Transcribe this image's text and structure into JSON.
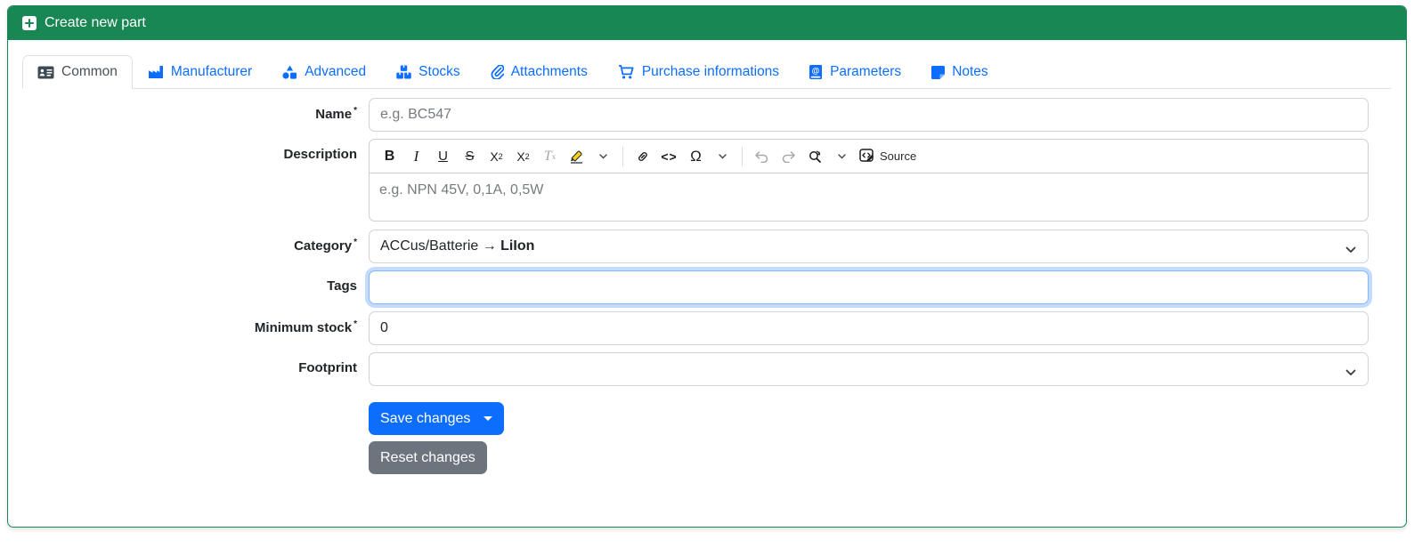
{
  "header": {
    "title": "Create new part",
    "icon": "plus-square-icon",
    "background": "#198754"
  },
  "tabs": [
    {
      "label": "Common",
      "icon": "id-card-icon",
      "active": true
    },
    {
      "label": "Manufacturer",
      "icon": "factory-icon",
      "active": false
    },
    {
      "label": "Advanced",
      "icon": "shapes-icon",
      "active": false
    },
    {
      "label": "Stocks",
      "icon": "boxes-icon",
      "active": false
    },
    {
      "label": "Attachments",
      "icon": "paperclip-icon",
      "active": false
    },
    {
      "label": "Purchase informations",
      "icon": "cart-icon",
      "active": false
    },
    {
      "label": "Parameters",
      "icon": "book-at-icon",
      "active": false
    },
    {
      "label": "Notes",
      "icon": "sticky-note-icon",
      "active": false
    }
  ],
  "form": {
    "name": {
      "label": "Name",
      "required_marker": "*",
      "placeholder": "e.g. BC547",
      "value": ""
    },
    "description": {
      "label": "Description",
      "placeholder": "e.g. NPN 45V, 0,1A, 0,5W"
    },
    "category": {
      "label": "Category",
      "required_marker": "*",
      "value_prefix": "ACCus/Batterie → ",
      "value_selected": "LiIon"
    },
    "tags": {
      "label": "Tags",
      "value": "",
      "focused": true
    },
    "minimum_stock": {
      "label": "Minimum stock",
      "required_marker": "*",
      "value": "0"
    },
    "footprint": {
      "label": "Footprint",
      "value": ""
    }
  },
  "editor_toolbar": {
    "bold": "B",
    "italic": "I",
    "underline": "U",
    "strikethrough": "S",
    "subscript_base": "X",
    "subscript_small": "2",
    "superscript_base": "X",
    "superscript_small": "2",
    "remove_format_base": "T",
    "remove_format_small": "x",
    "code": "<>",
    "special_char": "Ω",
    "source_label": "Source"
  },
  "buttons": {
    "save": "Save changes",
    "reset": "Reset changes"
  },
  "colors": {
    "header_green": "#198754",
    "tab_link_blue": "#0d6efd",
    "save_blue": "#0d6efd",
    "reset_gray": "#6c757d",
    "focus_ring": "#86b7fe"
  }
}
